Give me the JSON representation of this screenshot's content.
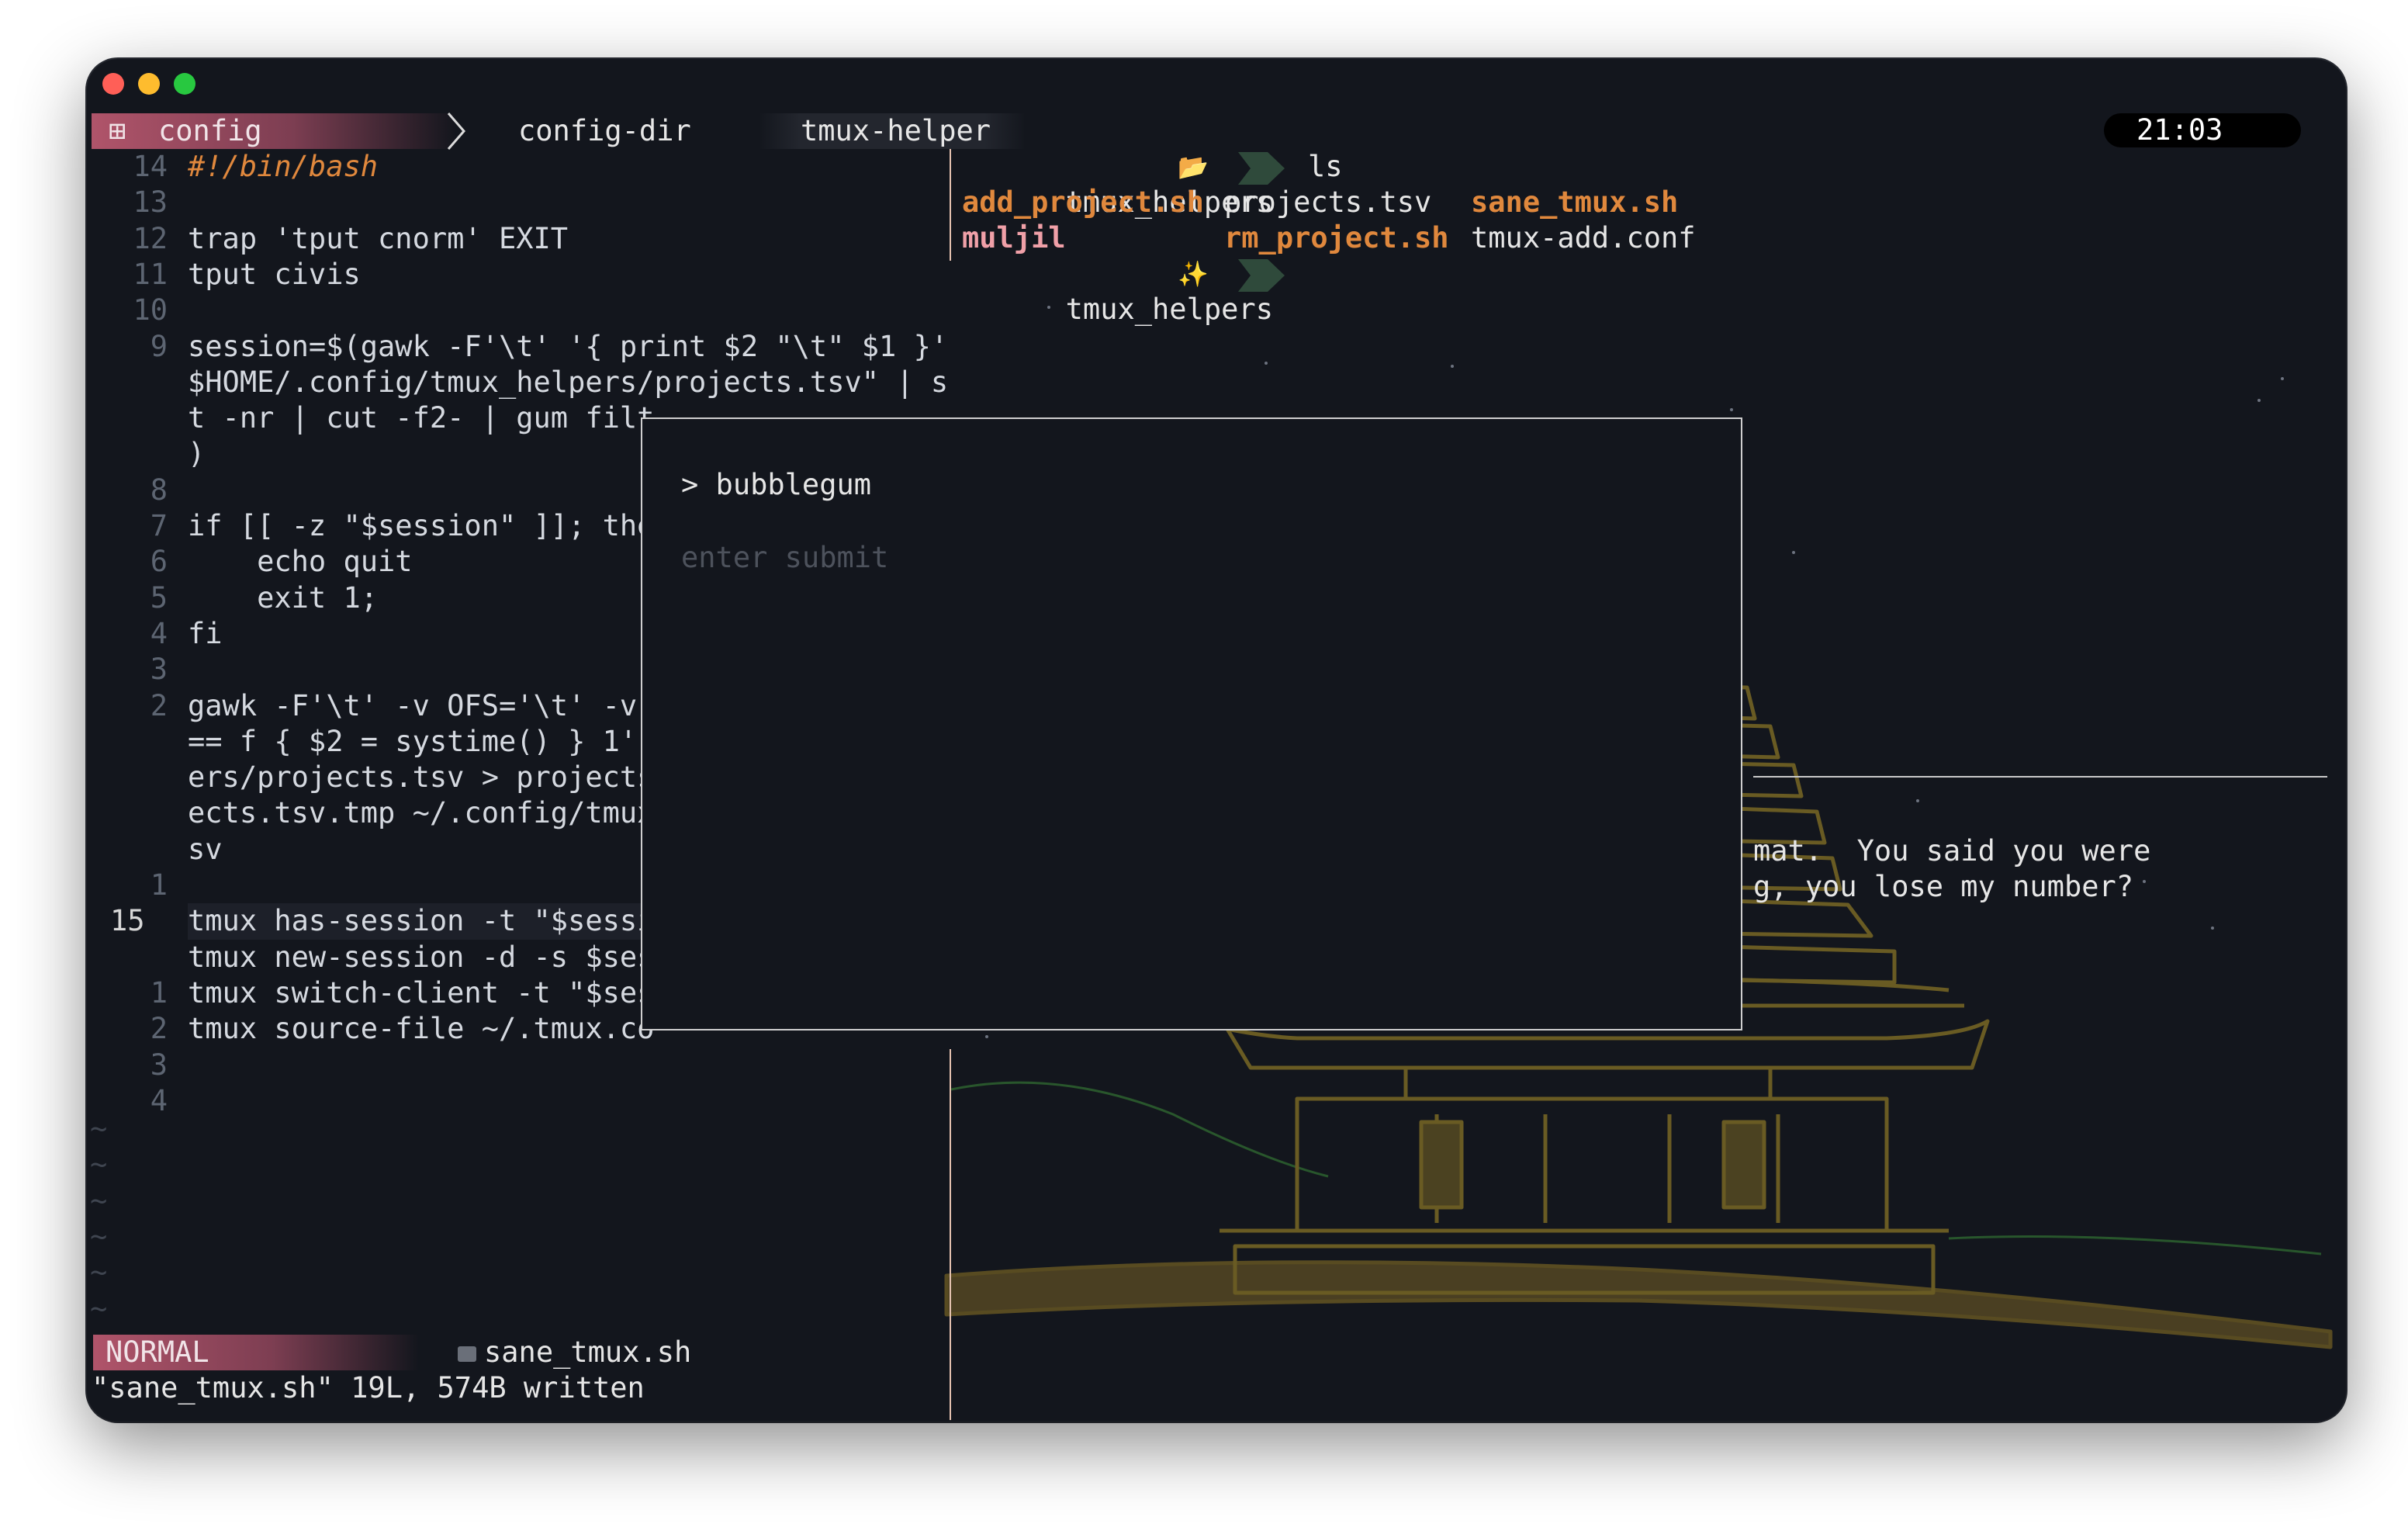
{
  "window": {
    "title_lights": [
      "close",
      "minimize",
      "maximize"
    ]
  },
  "tmux": {
    "session_name": "config",
    "tabs": [
      {
        "label": "config-dir",
        "active": false
      },
      {
        "label": "tmux-helper",
        "active": true
      }
    ],
    "clock": "21:03",
    "clock_icon": "apple-logo-icon"
  },
  "editor": {
    "mode": "NORMAL",
    "file_name": "sane_tmux.sh",
    "message": "\"sane_tmux.sh\" 19L, 574B written",
    "line_numbers": [
      "14",
      "13",
      "12",
      "11",
      "10",
      "9",
      "",
      "",
      "",
      "8",
      "7",
      "6",
      "5",
      "4",
      "3",
      "2",
      "",
      "",
      "",
      "",
      "1",
      "15",
      "",
      "1",
      "2",
      "3",
      "4"
    ],
    "current_line": "15",
    "lines": [
      "#!/bin/bash",
      "",
      "trap 'tput cnorm' EXIT",
      "tput civis",
      "",
      "session=$(gawk -F'\\t' '{ print $2 \"\\t\" $1 }' \"",
      "$HOME/.config/tmux_helpers/projects.tsv\" | sor",
      "t -nr | cut -f2- | gum filt",
      ")",
      "",
      "if [[ -z \"$session\" ]]; the",
      "    echo quit",
      "    exit 1;",
      "fi",
      "",
      "gawk -F'\\t' -v OFS='\\t' -v",
      "== f { $2 = systime() } 1'",
      "ers/projects.tsv > projects",
      "ects.tsv.tmp ~/.config/tmux",
      "sv",
      "",
      "tmux has-session -t \"$sessi",
      "tmux new-session -d -s $ses",
      "tmux switch-client -t \"$ses",
      "tmux source-file ~/.tmux.co",
      "",
      ""
    ],
    "tilde_count": 6
  },
  "shell": {
    "cwd": "tmux_helpers",
    "cwd_icon": "folder-icon",
    "command": "ls",
    "ls_output": [
      [
        "add_project.sh",
        "projects.tsv",
        "sane_tmux.sh"
      ],
      [
        "muljil",
        "rm_project.sh",
        "tmux-add.conf"
      ]
    ],
    "prompt2_cwd": "tmux_helpers",
    "prompt2_icon": "sparkles-icon"
  },
  "popup": {
    "prompt": "> bubblegum",
    "hint": "enter submit"
  },
  "right_text": [
    "mat.  You said you were",
    "g, you lose my number?"
  ],
  "colors": {
    "background": "#13161d",
    "accent_pink": "#b0546a",
    "executable": "#e0883d",
    "directory": "#f0a0a8",
    "drawing": "#7a6a2a",
    "prompt_arrow": "#2f4a3b"
  }
}
